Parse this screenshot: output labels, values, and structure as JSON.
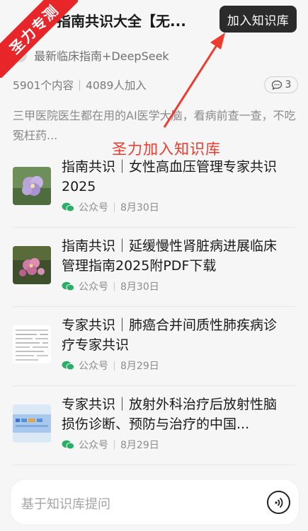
{
  "header": {
    "kb_title": "学指南共识大全【无...",
    "join_button": "加入知识库",
    "source": "最新临床指南+DeepSeek",
    "stats": {
      "contents": "5901个内容",
      "joined": "4089人加入"
    },
    "comment_count": "3",
    "description": "三甲医院医生都在用的AI医学大脑，看病前查一查，不吃冤枉药..."
  },
  "ribbon": {
    "text": "圣力专测"
  },
  "annotation": {
    "text": "圣力加入知识库",
    "color": "#ef3b2d"
  },
  "articles": [
    {
      "title": "指南共识｜女性高血压管理专家共识2025",
      "source": "公众号",
      "date": "8月30日",
      "thumb": "purple-flower"
    },
    {
      "title": "指南共识｜延缓慢性肾脏病进展临床管理指南2025附PDF下载",
      "source": "公众号",
      "date": "8月30日",
      "thumb": "pink-flower"
    },
    {
      "title": "专家共识｜肺癌合并间质性肺疾病诊疗专家共识",
      "source": "公众号",
      "date": "8月29日",
      "thumb": "document-table"
    },
    {
      "title": "专家共识｜放射外科治疗后放射性脑损伤诊断、预防与治疗的中国...",
      "source": "公众号",
      "date": "8月29日",
      "thumb": "blue-banner"
    }
  ],
  "ask": {
    "placeholder": "基于知识库提问"
  },
  "colors": {
    "accent_red": "#e8262a",
    "wechat_green": "#2aae67",
    "join_bg": "#2b2b2b"
  }
}
